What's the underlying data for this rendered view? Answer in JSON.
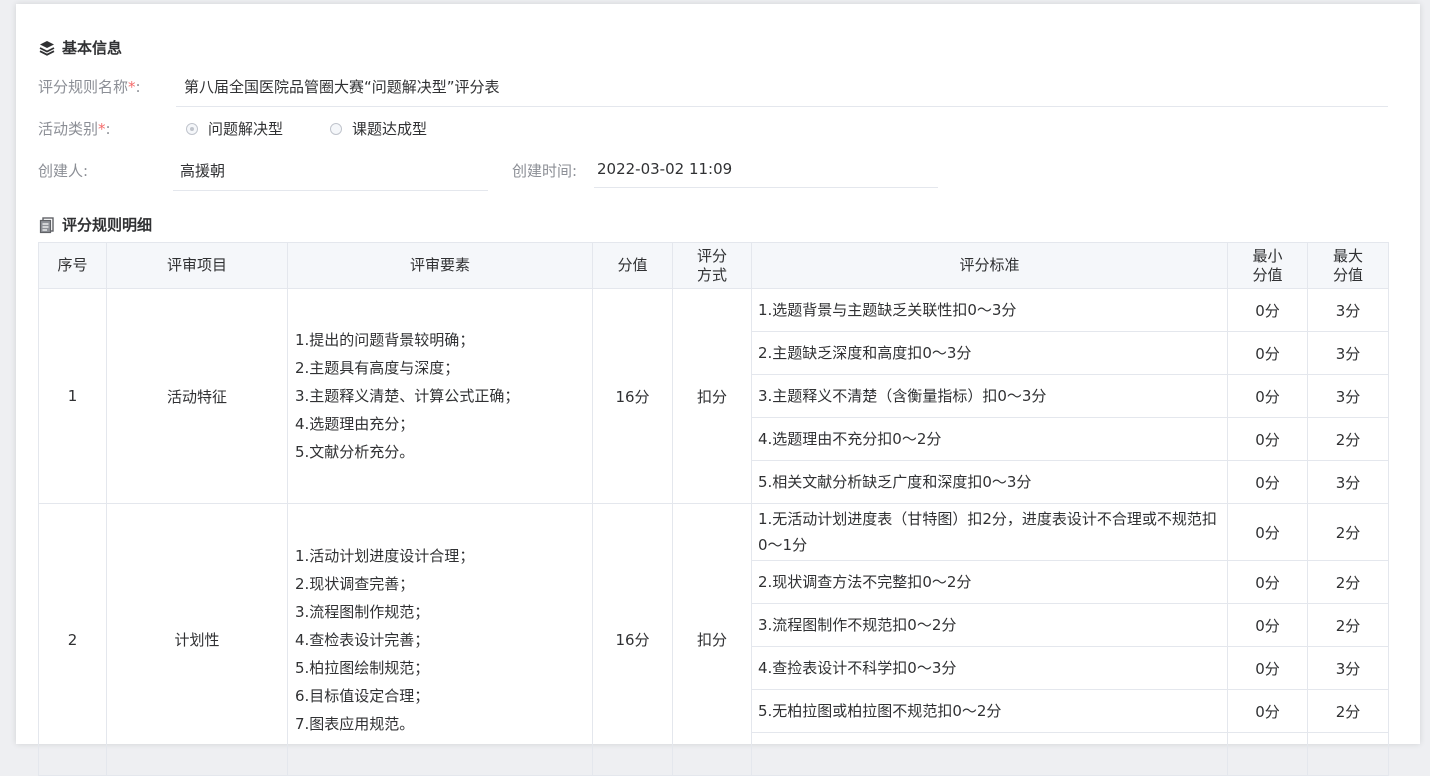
{
  "basic": {
    "title": "基本信息",
    "name_label": "评分规则名称",
    "name_value": "第八届全国医院品管圈大赛“问题解决型”评分表",
    "type_label": "活动类别",
    "type_options": [
      {
        "label": "问题解决型",
        "selected": true
      },
      {
        "label": "课题达成型",
        "selected": false
      }
    ],
    "creator_label": "创建人:",
    "creator_value": "高援朝",
    "created_time_label": "创建时间:",
    "created_time_value": "2022-03-02 11:09",
    "required_mark": "*",
    "colon": ":"
  },
  "detail": {
    "title": "评分规则明细",
    "headers": {
      "seq": "序号",
      "item": "评审项目",
      "elements": "评审要素",
      "score": "分值",
      "method_line1": "评分",
      "method_line2": "方式",
      "standard": "评分标准",
      "min_line1": "最小",
      "min_line2": "分值",
      "max_line1": "最大",
      "max_line2": "分值"
    },
    "rows": [
      {
        "seq": "1",
        "item": "活动特征",
        "elements": [
          "1.提出的问题背景较明确；",
          "2.主题具有高度与深度；",
          "3.主题释义清楚、计算公式正确；",
          "4.选题理由充分；",
          "5.文献分析充分。"
        ],
        "score": "16分",
        "method": "扣分",
        "standards": [
          {
            "text": "1.选题背景与主题缺乏关联性扣0～3分",
            "min": "0分",
            "max": "3分"
          },
          {
            "text": "2.主题缺乏深度和高度扣0～3分",
            "min": "0分",
            "max": "3分"
          },
          {
            "text": "3.主题释义不清楚（含衡量指标）扣0～3分",
            "min": "0分",
            "max": "3分"
          },
          {
            "text": "4.选题理由不充分扣0～2分",
            "min": "0分",
            "max": "2分"
          },
          {
            "text": "5.相关文献分析缺乏广度和深度扣0～3分",
            "min": "0分",
            "max": "3分"
          }
        ]
      },
      {
        "seq": "2",
        "item": "计划性",
        "elements": [
          "1.活动计划进度设计合理；",
          "2.现状调查完善；",
          "3.流程图制作规范；",
          "4.查检表设计完善；",
          "5.柏拉图绘制规范；",
          "6.目标值设定合理；",
          "7.图表应用规范。"
        ],
        "score": "16分",
        "method": "扣分",
        "standards": [
          {
            "text": "1.无活动计划进度表（甘特图）扣2分，进度表设计不合理或不规范扣0～1分",
            "min": "0分",
            "max": "2分"
          },
          {
            "text": "2.现状调查方法不完整扣0～2分",
            "min": "0分",
            "max": "2分"
          },
          {
            "text": "3.流程图制作不规范扣0～2分",
            "min": "0分",
            "max": "2分"
          },
          {
            "text": "4.查捡表设计不科学扣0～3分",
            "min": "0分",
            "max": "3分"
          },
          {
            "text": "5.无柏拉图或柏拉图不规范扣0～2分",
            "min": "0分",
            "max": "2分"
          },
          {
            "text": "",
            "min": "",
            "max": ""
          }
        ]
      }
    ]
  }
}
